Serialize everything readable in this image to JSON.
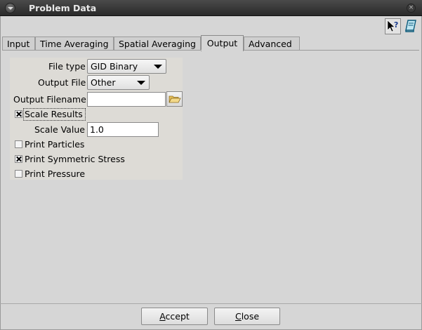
{
  "window": {
    "title": "Problem Data",
    "menu_icon": "chevron-down-icon",
    "close_icon": "close-icon",
    "close_glyph": "×"
  },
  "toolbar": {
    "help_icon": "context-help-icon",
    "book_icon": "book-icon"
  },
  "tabs": [
    {
      "label": "Input",
      "active": false
    },
    {
      "label": "Time Averaging",
      "active": false
    },
    {
      "label": "Spatial Averaging",
      "active": false
    },
    {
      "label": "Output",
      "active": true
    },
    {
      "label": "Advanced",
      "active": false
    }
  ],
  "form": {
    "file_type": {
      "label": "File type",
      "value": "GID Binary"
    },
    "output_file": {
      "label": "Output File",
      "value": "Other"
    },
    "output_filename": {
      "label": "Output Filename",
      "value": ""
    },
    "scale_results": {
      "label": "Scale Results",
      "checked": true
    },
    "scale_value": {
      "label": "Scale Value",
      "value": "1.0"
    },
    "print_particles": {
      "label": "Print Particles",
      "checked": false
    },
    "print_symmetric_stress": {
      "label": "Print Symmetric Stress",
      "checked": true
    },
    "print_pressure": {
      "label": "Print Pressure",
      "checked": false
    }
  },
  "buttons": {
    "accept": {
      "mnemonic": "A",
      "rest": "ccept"
    },
    "close": {
      "mnemonic": "C",
      "rest": "lose"
    }
  }
}
